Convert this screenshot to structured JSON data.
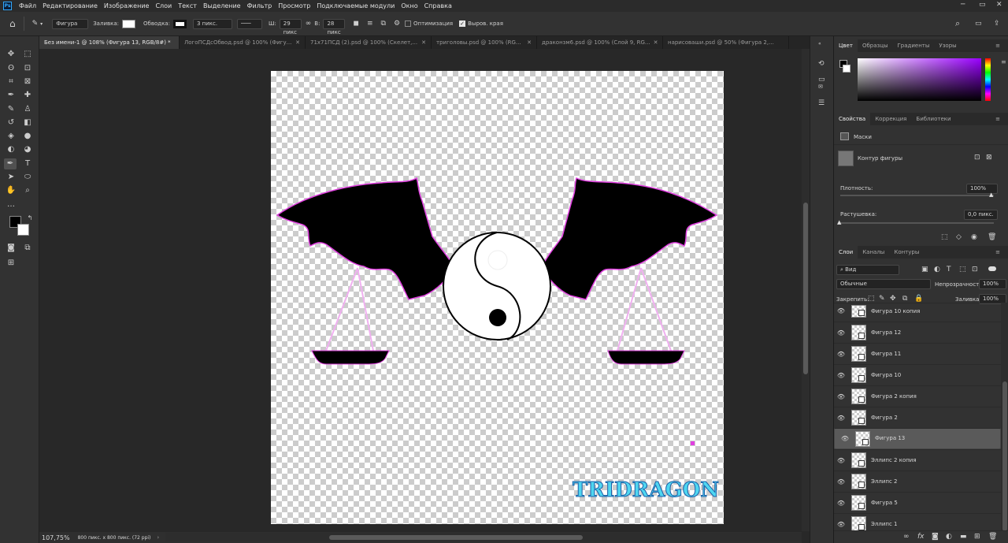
{
  "menu": [
    "Файл",
    "Редактирование",
    "Изображение",
    "Слои",
    "Текст",
    "Выделение",
    "Фильтр",
    "Просмотр",
    "Подключаемые модули",
    "Окно",
    "Справка"
  ],
  "options": {
    "mode": "Фигура",
    "fill_label": "Заливка:",
    "stroke_label": "Обводка:",
    "stroke_width": "3 пикс.",
    "w_label": "Ш:",
    "w_value": "29 пикс",
    "h_label": "В:",
    "h_value": "28 пикс",
    "optimize_label": "Оптимизация",
    "align_label": "Выров. края"
  },
  "tabs": [
    {
      "label": "Без имени-1 @ 108% (Фигура 13, RGB/8#) *",
      "active": true
    },
    {
      "label": "ЛогоПСДсОбвод.psd @ 100% (Фигу...",
      "active": false
    },
    {
      "label": "71х71ПСД (2).psd @ 100% (Скелет,...",
      "active": false
    },
    {
      "label": "триголовы.psd @ 100% (RG...",
      "active": false
    },
    {
      "label": "драконзм6.psd @ 100% (Слой 9, RG...",
      "active": false
    },
    {
      "label": "нарисоваши.psd @ 50% (Фигура 2,...",
      "active": false
    }
  ],
  "canvas": {
    "logo_text": "TRIDRAGON"
  },
  "status": {
    "zoom": "107,75%",
    "size": "800 пикс. x 800 пикс. (72 ppi)"
  },
  "color_panel": {
    "tabs": [
      "Цвет",
      "Образцы",
      "Градиенты",
      "Узоры"
    ]
  },
  "properties_panel": {
    "tabs": [
      "Свойства",
      "Коррекция",
      "Библиотеки"
    ],
    "masks_label": "Маски",
    "contour_label": "Контур фигуры",
    "density_label": "Плотность:",
    "density_value": "100%",
    "feather_label": "Растушевка:",
    "feather_value": "0,0 пикс."
  },
  "layers_panel": {
    "tabs": [
      "Слои",
      "Каналы",
      "Контуры"
    ],
    "filter": "Вид",
    "blend_mode": "Обычные",
    "opacity_label": "Непрозрачность:",
    "opacity_value": "100%",
    "lock_label": "Закрепить:",
    "fill_label": "Заливка:",
    "fill_value": "100%",
    "layers": [
      {
        "name": "Фигура 10 копия",
        "selected": false
      },
      {
        "name": "Фигура 12",
        "selected": false
      },
      {
        "name": "Фигура 11",
        "selected": false
      },
      {
        "name": "Фигура 10",
        "selected": false
      },
      {
        "name": "Фигура 2 копия",
        "selected": false
      },
      {
        "name": "Фигура 2",
        "selected": false
      },
      {
        "name": "Фигура 13",
        "selected": true
      },
      {
        "name": "Эллипс 2 копия",
        "selected": false
      },
      {
        "name": "Эллипс 2",
        "selected": false
      },
      {
        "name": "Фигура 5",
        "selected": false
      },
      {
        "name": "Эллипс 1",
        "selected": false
      }
    ]
  },
  "colors": {
    "accent": "#31a8ff",
    "magenta": "#e040e0"
  }
}
